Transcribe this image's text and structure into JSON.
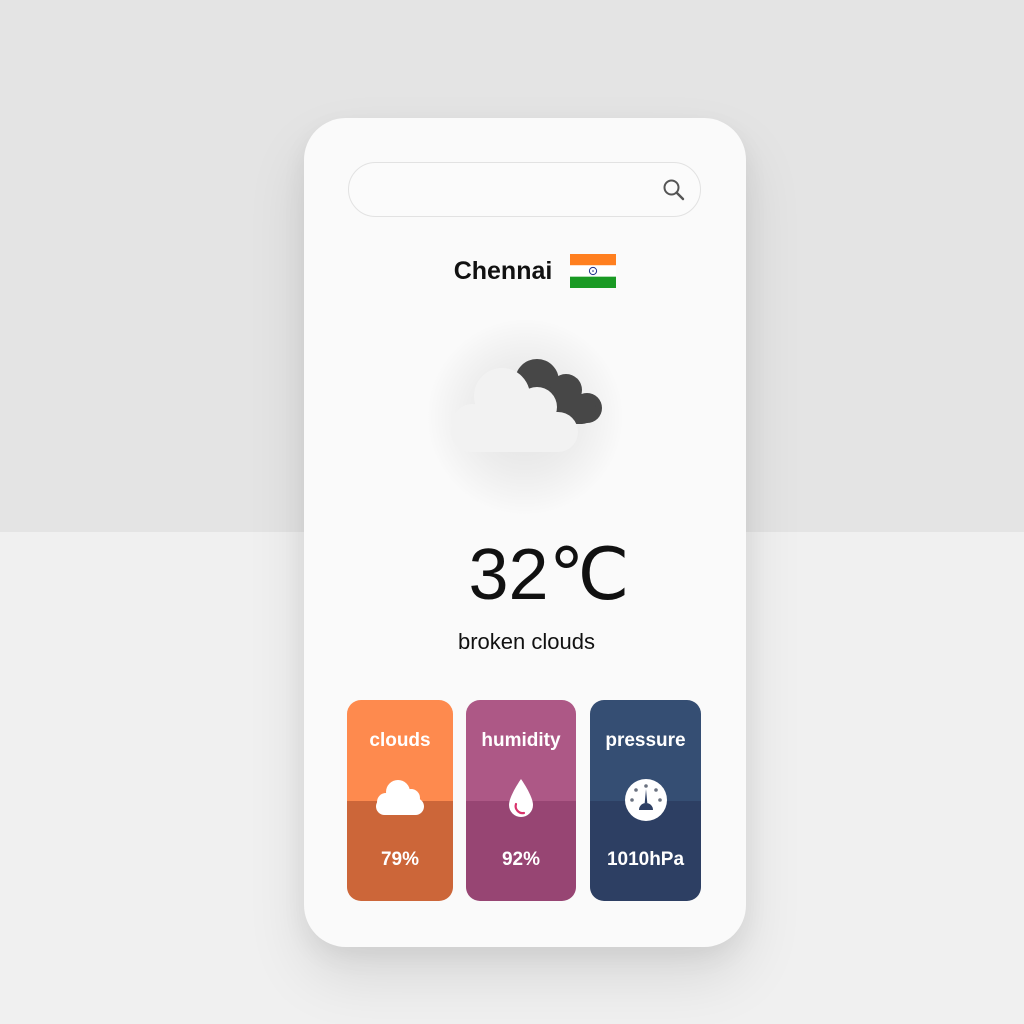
{
  "search": {
    "value": "",
    "placeholder": "",
    "icon": "search-icon"
  },
  "location": {
    "city": "Chennai",
    "country_flag": "india-flag-icon"
  },
  "weather": {
    "icon": "broken-clouds-icon",
    "temperature": "32℃",
    "description": "broken clouds"
  },
  "stats": [
    {
      "label": "clouds",
      "value": "79%",
      "icon": "cloud-icon",
      "color_top": "#fe8a4e",
      "color_bottom": "#cc6639"
    },
    {
      "label": "humidity",
      "value": "92%",
      "icon": "droplet-icon",
      "color_top": "#ad5886",
      "color_bottom": "#974573"
    },
    {
      "label": "pressure",
      "value": "1010hPa",
      "icon": "gauge-icon",
      "color_top": "#354e73",
      "color_bottom": "#2d3f63"
    }
  ],
  "colors": {
    "page_top": "#e4e4e4",
    "page_bottom": "#f0f0f0",
    "card": "#fafafa"
  }
}
